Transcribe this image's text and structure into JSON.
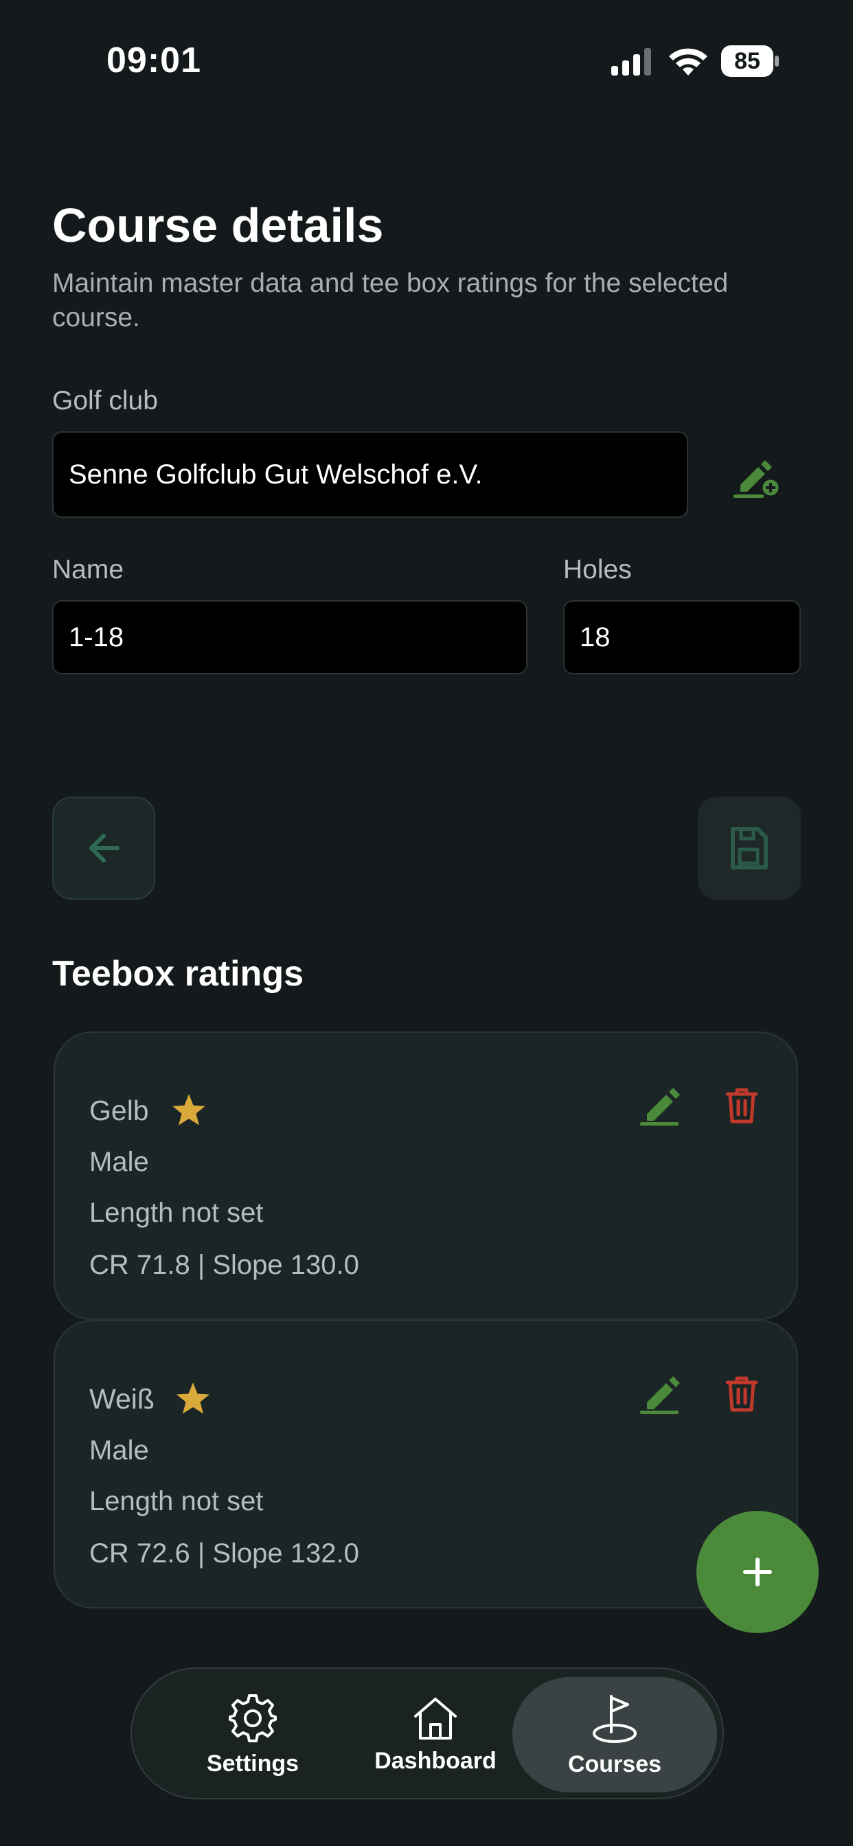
{
  "status_bar": {
    "time": "09:01",
    "battery": "85"
  },
  "header": {
    "title": "Course details",
    "subtitle": "Maintain master data and tee box ratings for the selected course."
  },
  "form": {
    "golf_club_label": "Golf club",
    "golf_club_value": "Senne Golfclub Gut Welschof e.V.",
    "name_label": "Name",
    "name_value": "1-18",
    "holes_label": "Holes",
    "holes_value": "18"
  },
  "teebox": {
    "section_title": "Teebox ratings",
    "items": [
      {
        "name": "Gelb",
        "gender": "Male",
        "length": "Length not set",
        "rating": "CR 71.8 | Slope 130.0"
      },
      {
        "name": "Weiß",
        "gender": "Male",
        "length": "Length not set",
        "rating": "CR 72.6 | Slope 132.0"
      }
    ]
  },
  "nav": {
    "items": [
      {
        "label": "Settings"
      },
      {
        "label": "Dashboard"
      },
      {
        "label": "Courses"
      }
    ],
    "active": "Courses"
  },
  "colors": {
    "background": "#141a1b",
    "accent_green": "#4a8a3a",
    "delete_red": "#c0392b",
    "star_gold": "#d9a93a"
  },
  "icons": {
    "back": "arrow-left-icon",
    "save": "save-icon",
    "edit": "pencil-icon",
    "delete": "trash-icon",
    "add": "plus-icon",
    "golf_club_edit": "pencil-plus-icon",
    "settings": "gear-icon",
    "dashboard": "home-icon",
    "courses": "flag-icon"
  }
}
